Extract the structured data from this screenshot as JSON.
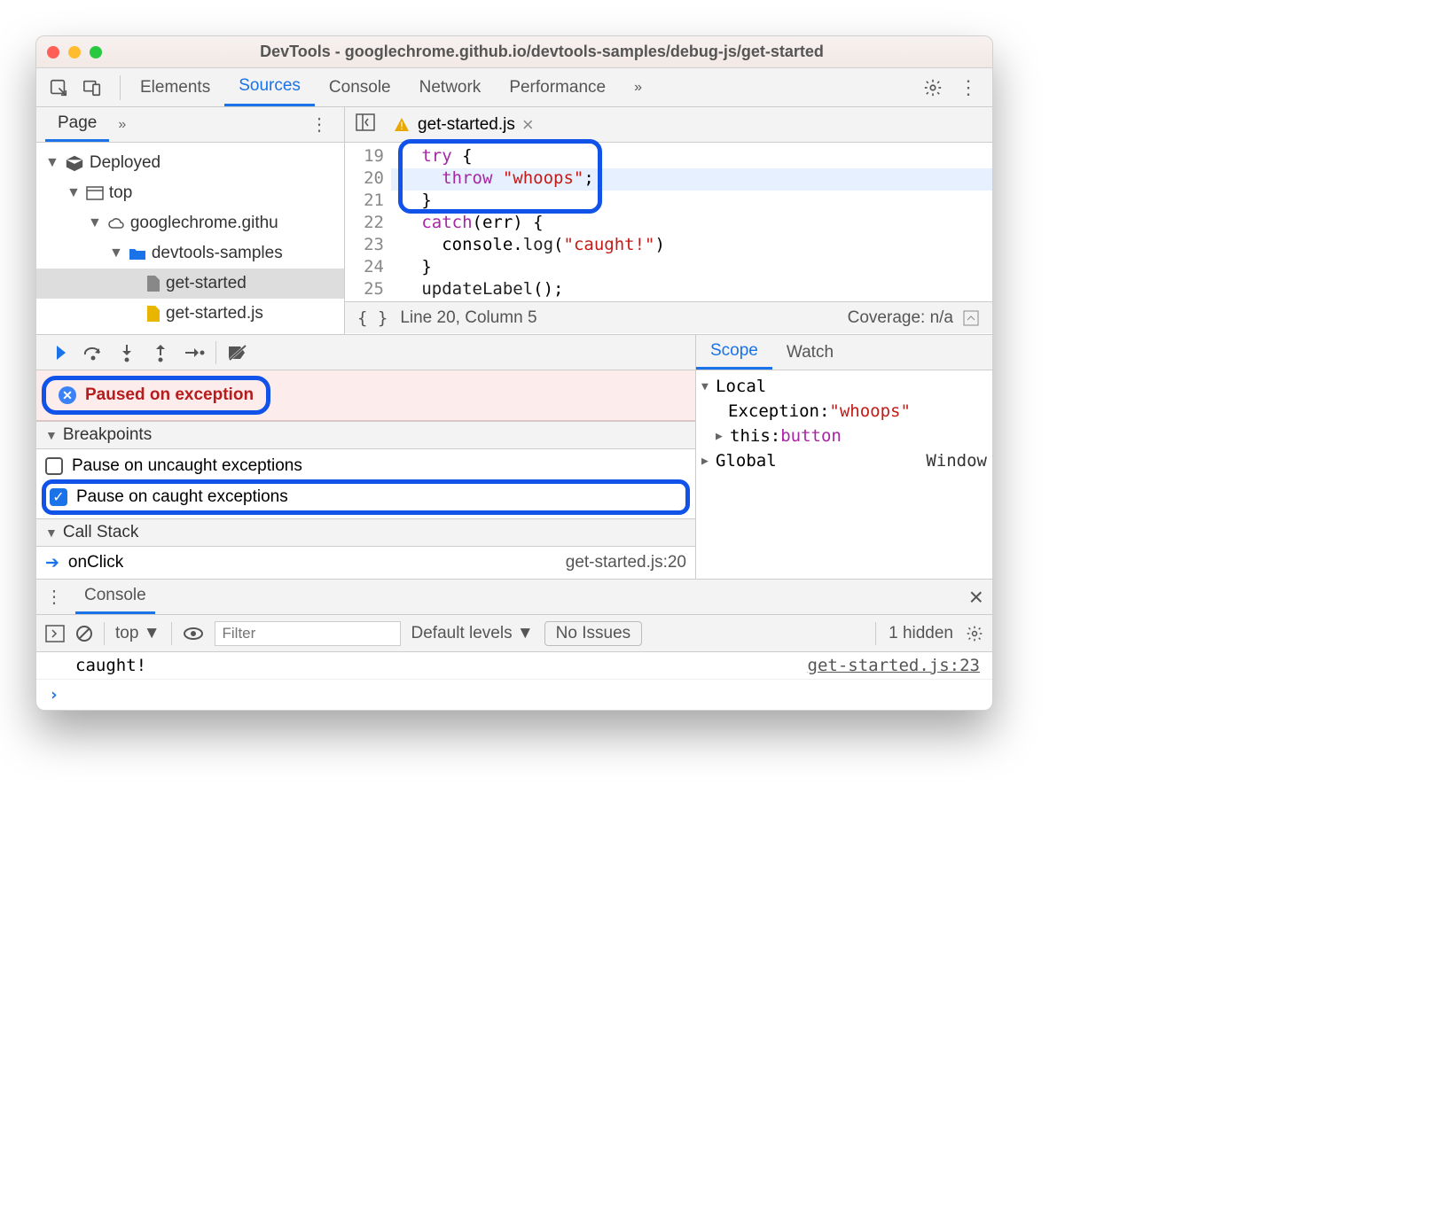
{
  "window": {
    "title": "DevTools - googlechrome.github.io/devtools-samples/debug-js/get-started"
  },
  "tabs": {
    "elements": "Elements",
    "sources": "Sources",
    "console": "Console",
    "network": "Network",
    "performance": "Performance",
    "more": "»"
  },
  "navigator": {
    "page_tab": "Page",
    "more": "»",
    "root": "Deployed",
    "top": "top",
    "domain": "googlechrome.githu",
    "folder": "devtools-samples",
    "file_html": "get-started",
    "file_js": "get-started.js"
  },
  "editor": {
    "filename": "get-started.js",
    "lines": {
      "19": "try {",
      "20_kw": "throw",
      "20_str": "\"whoops\"",
      "20_tail": ";",
      "21": "}",
      "22_a": "catch",
      "22_b": "(err) {",
      "23_a": "console.",
      "23_b": "log",
      "23_c": "(",
      "23_str": "\"caught!\"",
      "23_d": ")",
      "24": "}",
      "25_a": "updateLabel",
      "25_b": "();"
    }
  },
  "status": {
    "cursor": "Line 20, Column 5",
    "coverage": "Coverage: n/a"
  },
  "paused": {
    "label": "Paused on exception"
  },
  "breakpoints": {
    "header": "Breakpoints",
    "uncaught": "Pause on uncaught exceptions",
    "caught": "Pause on caught exceptions"
  },
  "callstack": {
    "header": "Call Stack",
    "frame": "onClick",
    "loc": "get-started.js:20"
  },
  "scope": {
    "tab_scope": "Scope",
    "tab_watch": "Watch",
    "local": "Local",
    "exception_k": "Exception: ",
    "exception_v": "\"whoops\"",
    "this_k": "this: ",
    "this_v": "button",
    "global": "Global",
    "global_v": "Window"
  },
  "drawer": {
    "tab": "Console"
  },
  "console_toolbar": {
    "context": "top",
    "filter_ph": "Filter",
    "levels": "Default levels",
    "issues": "No Issues",
    "hidden": "1 hidden"
  },
  "console": {
    "msg": "caught!",
    "src": "get-started.js:23"
  }
}
